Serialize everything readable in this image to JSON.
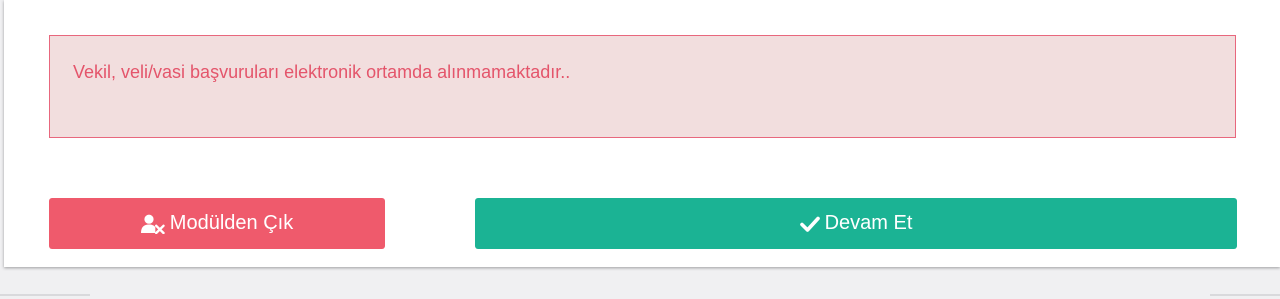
{
  "alert": {
    "message": "Vekil, veli/vasi başvuruları elektronik ortamda alınmamaktadır.."
  },
  "actions": {
    "exit_label": "Modülden Çık",
    "exit_icon": "user-times-icon",
    "continue_label": "Devam Et",
    "continue_icon": "check-icon"
  },
  "colors": {
    "alert_background": "#f2dede",
    "alert_border": "#e8677d",
    "alert_text": "#e4556b",
    "exit_button": "#ef5a6c",
    "continue_button": "#1bb394"
  }
}
